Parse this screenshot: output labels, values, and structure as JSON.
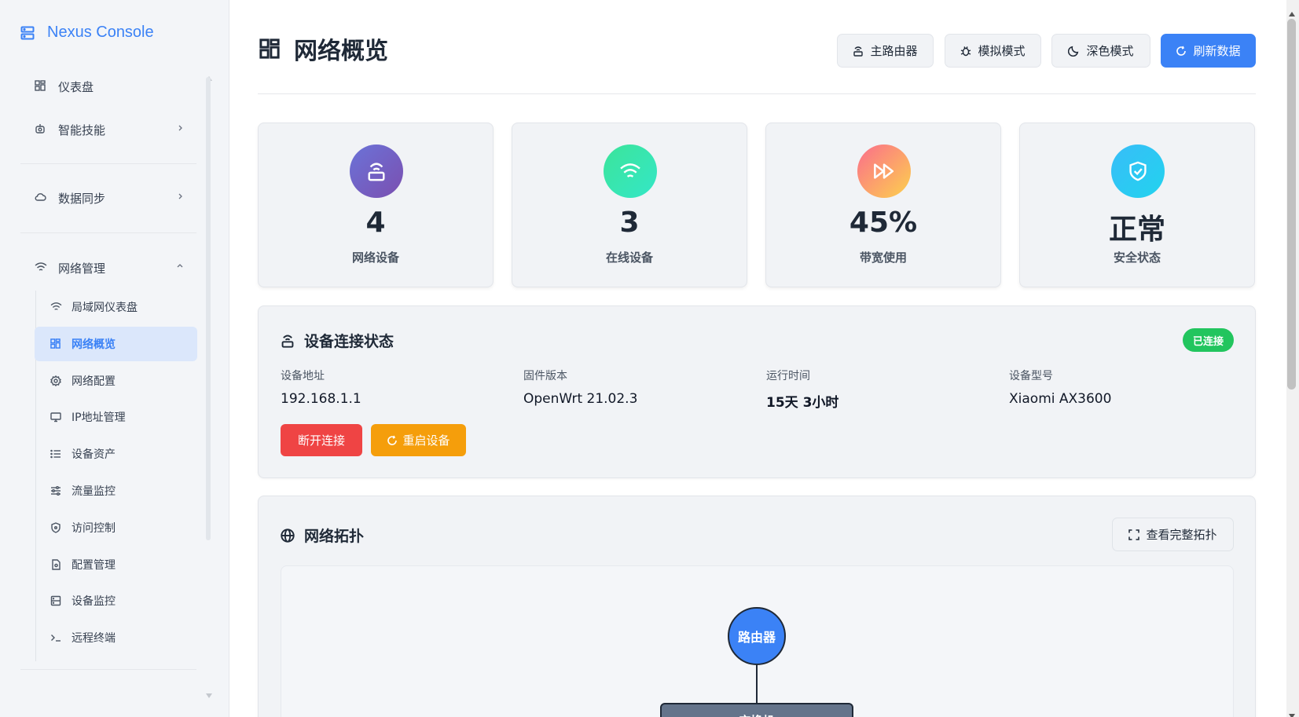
{
  "brand": {
    "name": "Nexus Console"
  },
  "sidebar": {
    "items": [
      {
        "label": "仪表盘"
      },
      {
        "label": "智能技能"
      },
      {
        "label": "数据同步"
      },
      {
        "label": "网络管理"
      }
    ],
    "network_sub": [
      {
        "label": "局域网仪表盘"
      },
      {
        "label": "网络概览"
      },
      {
        "label": "网络配置"
      },
      {
        "label": "IP地址管理"
      },
      {
        "label": "设备资产"
      },
      {
        "label": "流量监控"
      },
      {
        "label": "访问控制"
      },
      {
        "label": "配置管理"
      },
      {
        "label": "设备监控"
      },
      {
        "label": "远程终端"
      }
    ]
  },
  "header": {
    "title": "网络概览",
    "buttons": {
      "router": "主路由器",
      "simulate": "模拟模式",
      "dark": "深色模式",
      "refresh": "刷新数据"
    }
  },
  "stats": [
    {
      "value": "4",
      "label": "网络设备"
    },
    {
      "value": "3",
      "label": "在线设备"
    },
    {
      "value": "45%",
      "label": "带宽使用"
    },
    {
      "value": "正常",
      "label": "安全状态"
    }
  ],
  "connection": {
    "title": "设备连接状态",
    "status": "已连接",
    "fields": [
      {
        "label": "设备地址",
        "value": "192.168.1.1"
      },
      {
        "label": "固件版本",
        "value": "OpenWrt 21.02.3"
      },
      {
        "label": "运行时间",
        "value": "15天 3小时"
      },
      {
        "label": "设备型号",
        "value": "Xiaomi AX3600"
      }
    ],
    "disconnect": "断开连接",
    "reboot": "重启设备"
  },
  "topology": {
    "title": "网络拓扑",
    "view_full": "查看完整拓扑",
    "router_node": "路由器",
    "switch_node": "交换机"
  },
  "colors": {
    "accent": "#3b82f6",
    "danger": "#ef4444",
    "warning": "#f59e0b",
    "success": "#22c55e"
  }
}
